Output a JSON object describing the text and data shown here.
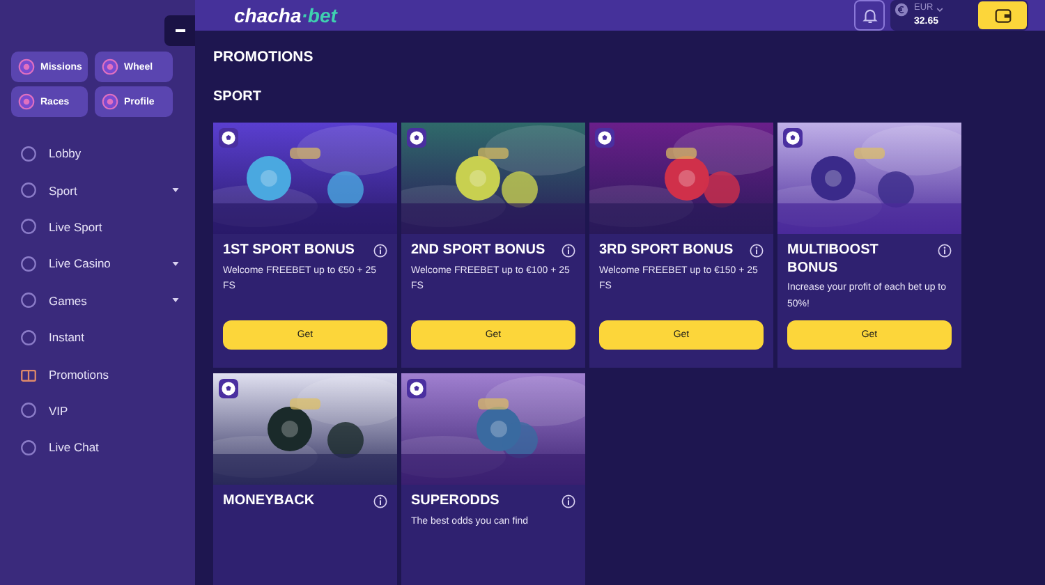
{
  "logo": {
    "primary": "chacha",
    "accent": "·bet"
  },
  "wallet": {
    "currency": "EUR",
    "balance": "32.65"
  },
  "quick_links": [
    {
      "label": "Missions"
    },
    {
      "label": "Wheel"
    },
    {
      "label": "Races"
    },
    {
      "label": "Profile"
    }
  ],
  "sidebar": {
    "items": [
      {
        "label": "Lobby",
        "has_submenu": false
      },
      {
        "label": "Sport",
        "has_submenu": true
      },
      {
        "label": "Live Sport",
        "has_submenu": false
      },
      {
        "label": "Live Casino",
        "has_submenu": true
      },
      {
        "label": "Games",
        "has_submenu": true
      },
      {
        "label": "Instant",
        "has_submenu": false
      },
      {
        "label": "Promotions",
        "has_submenu": false
      },
      {
        "label": "VIP",
        "has_submenu": false
      },
      {
        "label": "Live Chat",
        "has_submenu": false
      }
    ]
  },
  "page_title": "PROMOTIONS",
  "section_title": "SPORT",
  "cards": [
    {
      "title": "1ST SPORT BONUS",
      "description": "Welcome FREEBET up to €50 + 25 FS",
      "button": "Get"
    },
    {
      "title": "2ND SPORT BONUS",
      "description": "Welcome FREEBET up to €100 + 25 FS",
      "button": "Get"
    },
    {
      "title": "3RD SPORT BONUS",
      "description": "Welcome FREEBET up to €150 + 25 FS",
      "button": "Get"
    },
    {
      "title": "MULTIBOOST BONUS",
      "description": "Increase your profit of each bet up to 50%!",
      "button": "Get"
    },
    {
      "title": "MONEYBACK"
    },
    {
      "title": "SUPERODDS",
      "description": "The best odds you can find"
    }
  ]
}
